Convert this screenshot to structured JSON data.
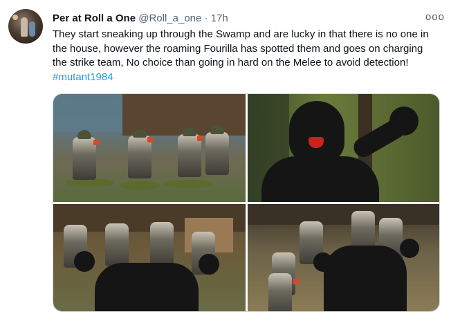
{
  "tweet": {
    "author_name": "Per at Roll a One",
    "handle": "@Roll_a_one",
    "separator": "·",
    "time": "17h",
    "more_label": "ooo",
    "text": "They start sneaking up through the Swamp and are lucky in that there is no one in the house, however the roaming Fourilla has spotted them and goes on charging the strike team, No choice than going in hard on the Melee to avoid detection! ",
    "hashtag": "#mutant1984"
  },
  "media": {
    "photos": [
      {
        "id": "photo-1"
      },
      {
        "id": "photo-2"
      },
      {
        "id": "photo-3"
      },
      {
        "id": "photo-4"
      }
    ]
  },
  "colors": {
    "text": "#0f1419",
    "secondary": "#536471",
    "link": "#1d9bf0",
    "border": "#cfd9de"
  }
}
